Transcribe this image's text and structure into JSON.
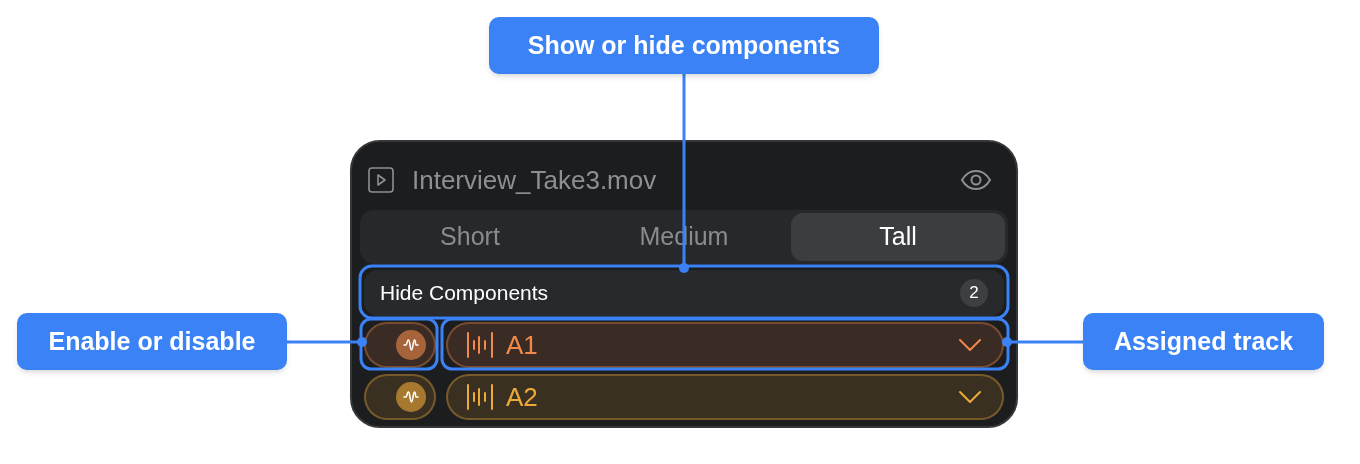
{
  "panel": {
    "file_name": "Interview_Take3.mov",
    "sizes": [
      {
        "label": "Short",
        "selected": false
      },
      {
        "label": "Medium",
        "selected": false
      },
      {
        "label": "Tall",
        "selected": true
      }
    ],
    "hide_components": {
      "label": "Hide Components",
      "count": "2"
    },
    "tracks": [
      {
        "label": "A1",
        "color": "#f0894a",
        "enabled": true
      },
      {
        "label": "A2",
        "color": "#eeaa38",
        "enabled": true
      }
    ]
  },
  "callouts": [
    {
      "text": "Show or hide components"
    },
    {
      "text": "Enable or disable"
    },
    {
      "text": "Assigned track"
    }
  ]
}
